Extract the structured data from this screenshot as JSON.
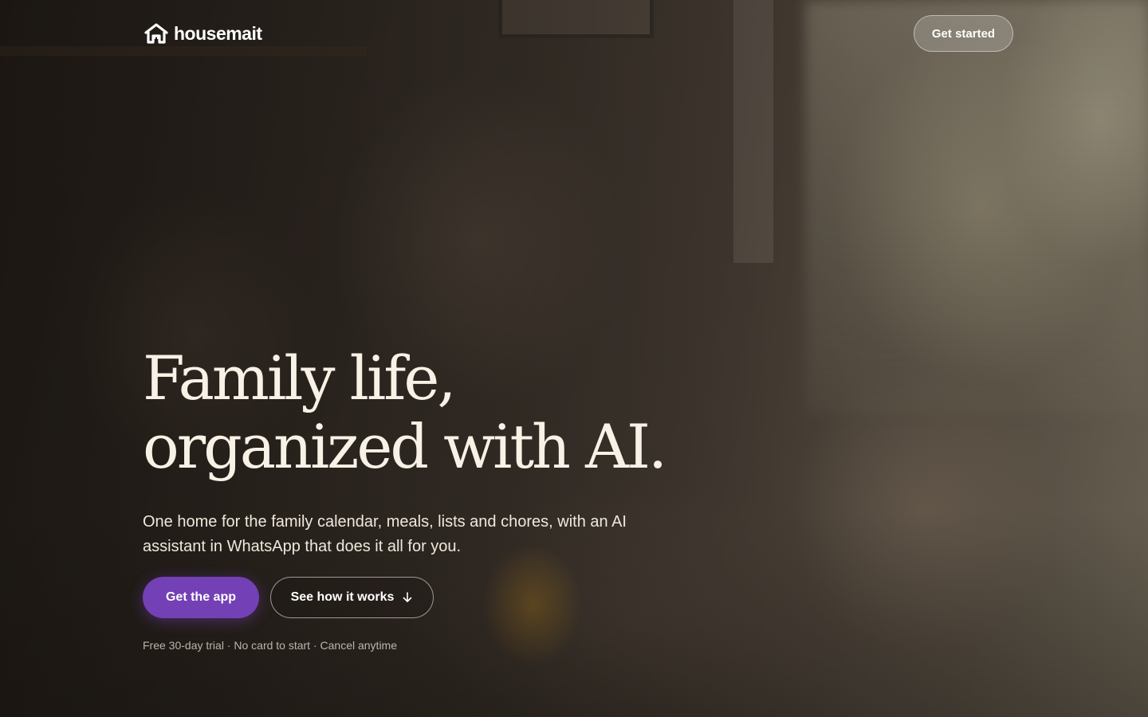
{
  "brand": {
    "name": "housemait",
    "logo_icon": "house-icon"
  },
  "header": {
    "cta_label": "Get started"
  },
  "hero": {
    "headline_line1": "Family life,",
    "headline_line2": "organized with AI.",
    "subtitle": "One home for the family calendar, meals, lists and chores, with an AI assistant in WhatsApp that does it all for you.",
    "primary_cta": "Get the app",
    "secondary_cta": "See how it works",
    "secondary_cta_icon": "arrow-down-icon",
    "fineprint": "Free 30-day trial · No card to start · Cancel anytime"
  },
  "colors": {
    "accent": "#7440b5",
    "text_light": "#f7f1e6"
  }
}
